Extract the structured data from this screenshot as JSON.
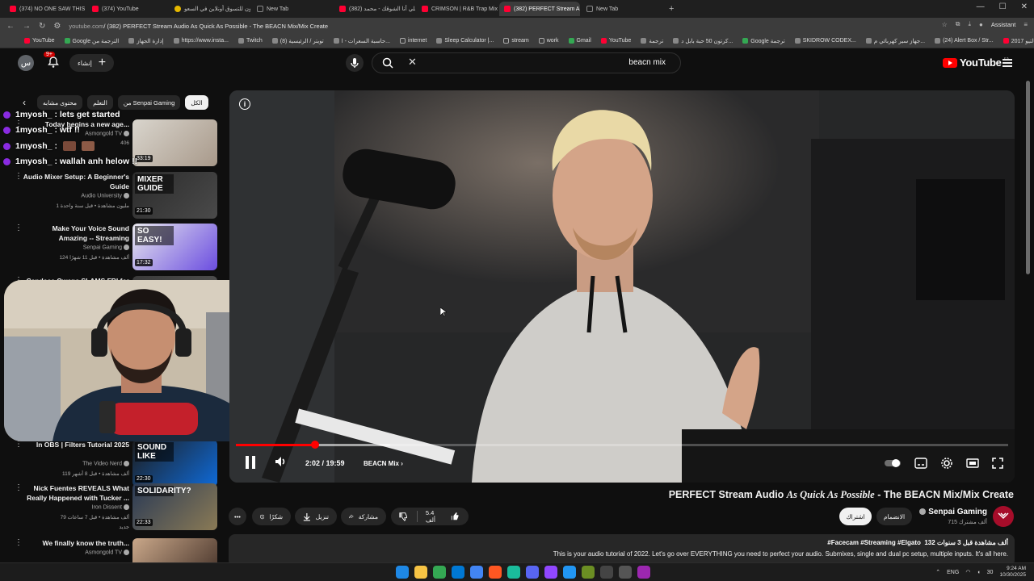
{
  "browser": {
    "tabs": [
      {
        "label": "(374) NO ONE SAW THIS CO",
        "fav": "youtube"
      },
      {
        "label": "(374) YouTube",
        "fav": "youtube"
      },
      {
        "label": "نون للتسوق أونلاين في السعو",
        "fav": "yellow"
      },
      {
        "label": "New Tab",
        "fav": "blank"
      },
      {
        "label": "علي أنا الشوقك - محمد (382)",
        "fav": "youtube"
      },
      {
        "label": "CRIMSON | R&B Trap Mix - Y",
        "fav": "youtube"
      },
      {
        "label": "(382) PERFECT Stream Audio",
        "fav": "youtube",
        "active": true
      },
      {
        "label": "New Tab",
        "fav": "blank"
      }
    ],
    "url_host": "youtube.com",
    "url_rest": "/ (382) PERFECT Stream Audio As Quick As Possible - The BEACN Mix/Mix Create",
    "assistant_label": "Assistant",
    "bookmarks": [
      "YouTube",
      "Google الترجمة من",
      "إدارة الجهاز",
      "https://www.insta...",
      "Twitch",
      "تويتر / الرئيسية (8)",
      "حاسبة السعرات - ا...",
      "internet",
      "Sleep Calculator |...",
      "stream",
      "work",
      "Gmail",
      "YouTube",
      "ترجمة",
      "كرتون 50 حبة بابل د...",
      "Google ترجمة",
      "SKIDROW CODEX...",
      "جهاز سير كهربائي م...",
      "(24) Alert Box / Str...",
      "مالتيو 2017+"
    ]
  },
  "masthead": {
    "avatar_letter": "س",
    "notif_count": "9+",
    "create_label": "إنشاء",
    "search_query": "beacn mix",
    "logo_text": "YouTube",
    "region": "SA"
  },
  "chips": [
    "الكل",
    "من Senpai Gaming",
    "التعلم",
    "محتوى مشابه"
  ],
  "chat": [
    "1myosh_ : lets get started",
    "1myosh_ : wtf !!",
    "1myosh_ :",
    "1myosh_ : wallah anh helow !!"
  ],
  "recommendations": [
    {
      "title": "Today begins a new age...",
      "channel": "Asmongold TV",
      "meta": "406",
      "duration": "33:19",
      "thumb": "robot"
    },
    {
      "title": "Audio Mixer Setup: A Beginner's Guide",
      "channel": "Audio University",
      "meta": "1 مليون مشاهدة • قبل سنة واحدة",
      "duration": "21:30",
      "thumb": "mixer",
      "thumb_text": "MIXER GUIDE"
    },
    {
      "title": "Make Your Voice Sound Amazing -- Streaming",
      "channel": "Senpai Gaming",
      "meta": "124 ألف مشاهدة • قبل 11 شهرًا",
      "duration": "17:32",
      "thumb": "voice",
      "thumb_text": "SO EASY!"
    },
    {
      "title": "Candace Owens SLAMS FBI for",
      "channel": "",
      "meta": "",
      "duration": "",
      "thumb": "news"
    },
    {
      "title": "In OBS | Filters Tutorial 2025",
      "channel": "The Video Nerd",
      "meta": "119 ألف مشاهدة • قبل 8 أشهر",
      "duration": "22:30",
      "thumb": "sound",
      "thumb_text": "SOUND LIKE"
    },
    {
      "title": "Nick Fuentes REVEALS What Really Happened with Tucker ...",
      "channel": "Iron Dissent",
      "meta": "79 ألف مشاهدة • قبل 7 ساعات",
      "badge": "جديد",
      "duration": "22:33",
      "thumb": "solidarity",
      "thumb_text": "SOLIDARITY?"
    },
    {
      "title": "We finally know the truth...",
      "channel": "Asmongold TV",
      "meta": "",
      "duration": "",
      "thumb": "truth"
    }
  ],
  "player": {
    "current_time": "2:02",
    "duration": "19:59",
    "time_sep": " / ",
    "chapter": "BEACN Mix",
    "progress_fraction": 0.102
  },
  "video": {
    "title_pre": "PERFECT Stream Audio ",
    "title_italic": "As Quick As Possible",
    "title_post": " - The BEACN Mix/Mix Create",
    "channel": "Senpai Gaming",
    "subscribers": "715 ألف مشترك",
    "join_label": "الانضمام",
    "subscribe_label": "اشتراك",
    "likes": "5.4 ألف",
    "share_label": "مشاركة",
    "download_label": "تنزيل",
    "thanks_label": "شكرًا",
    "desc_stats": "132 ألف مشاهدة  قبل 3 سنوات",
    "desc_tags": "#Facecam #Streaming #Elgato",
    "desc_text": "This is your audio tutorial of 2022. Let's go over EVERYTHING you need to perfect your audio. Submixes, single and dual pc setup, multiple inputs. It's all here."
  },
  "taskbar": {
    "lang": "ENG",
    "volume": "30",
    "time": "9:24 AM",
    "date": "10/30/2025"
  },
  "colors": {
    "accent": "#ff0000",
    "background": "#0f0f0f",
    "chip_selected": "#f1f1f1"
  }
}
